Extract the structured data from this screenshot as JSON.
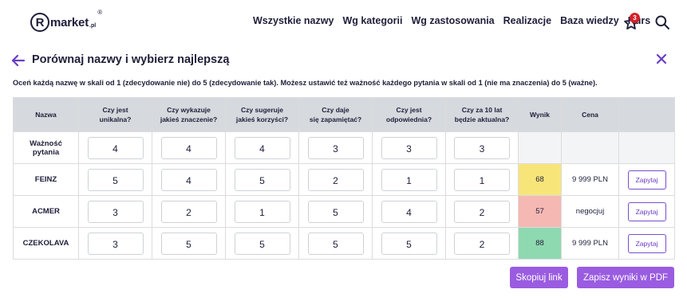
{
  "logo": {
    "letter": "R",
    "text": "market",
    "suffix": ".pl",
    "reg": "®"
  },
  "nav": [
    "Wszystkie nazwy",
    "Wg kategorii",
    "Wg zastosowania",
    "Realizacje",
    "Baza wiedzy",
    "Kurs"
  ],
  "favorites": {
    "count": "3"
  },
  "title": "Porównaj nazwy i wybierz najlepszą",
  "instructions": "Oceń każdą nazwę w skali od 1 (zdecydowanie nie) do 5 (zdecydowanie tak). Możesz ustawić też ważność każdego pytania w skali od 1 (nie ma znaczenia) do 5 (ważne).",
  "table": {
    "headers": {
      "name": "Nazwa",
      "q1a": "Czy jest",
      "q1b": "unikalna?",
      "q2a": "Czy wykazuje",
      "q2b": "jakieś znaczenie?",
      "q3a": "Czy sugeruje",
      "q3b": "jakieś korzyści?",
      "q4a": "Czy daje",
      "q4b": "się zapamiętać?",
      "q5a": "Czy jest",
      "q5b": "odpowiednia?",
      "q6a": "Czy za 10 lat",
      "q6b": "będzie aktualna?",
      "score": "Wynik",
      "price": "Cena"
    },
    "weights": {
      "label_a": "Ważność",
      "label_b": "pytania",
      "values": [
        "4",
        "4",
        "4",
        "3",
        "3",
        "3"
      ]
    },
    "rows": [
      {
        "name": "FEINZ",
        "values": [
          "5",
          "4",
          "5",
          "2",
          "1",
          "1"
        ],
        "score": "68",
        "price": "9 999 PLN",
        "action": "Zapytaj"
      },
      {
        "name": "ACMER",
        "values": [
          "3",
          "2",
          "1",
          "5",
          "4",
          "2"
        ],
        "score": "57",
        "price": "negocjuj",
        "action": "Zapytaj"
      },
      {
        "name": "CZEKOLAVA",
        "values": [
          "3",
          "5",
          "5",
          "5",
          "5",
          "2"
        ],
        "score": "88",
        "price": "9 999 PLN",
        "action": "Zapytaj"
      }
    ]
  },
  "buttons": {
    "copy": "Skopiuj link",
    "pdf": "Zapisz wyniki w PDF"
  },
  "colors": {
    "accent": "#9a5ce0",
    "score_high": "#8fd9b0",
    "score_mid": "#f7e57a",
    "score_low": "#f5b8b3",
    "badge": "#d4202a"
  }
}
